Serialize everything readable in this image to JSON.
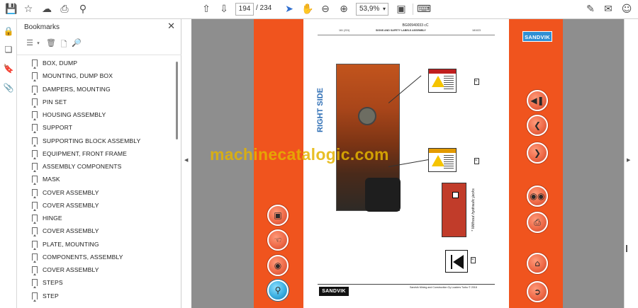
{
  "toolbar": {
    "current_page": "194",
    "total_pages": "/ 234",
    "zoom": "53,9%"
  },
  "bookmarks": {
    "title": "Bookmarks",
    "items": [
      "BOX, DUMP",
      "MOUNTING, DUMP BOX",
      "DAMPERS, MOUNTING",
      "PIN SET",
      "HOUSING ASSEMBLY",
      "SUPPORT",
      "SUPPORTING BLOCK ASSEMBLY",
      "EQUIPMENT, FRONT FRAME",
      "ASSEMBLY COMPONENTS",
      "MASK",
      "COVER ASSEMBLY",
      "COVER ASSEMBLY",
      "HINGE",
      "COVER ASSEMBLY",
      "PLATE, MOUNTING",
      "COMPONENTS, ASSEMBLY",
      "COVER ASSEMBLY",
      "STEPS",
      "STEP"
    ]
  },
  "document": {
    "doc_number": "BG00940033 cC",
    "page_ref": "161 (231)",
    "section_title": "SIGNS AND SAFETY LABELS ASSEMBLY",
    "date": "181023",
    "right_side_label": "RIGHT SIDE",
    "hydraulic_note": "* Without hydraulic jacks",
    "footer_logo": "SANDVIK",
    "footer_text": "Sandvik Mining and Construction Oy Loaders Turku © 2018",
    "tag_top": "53",
    "tag_mid": "51",
    "tag_bottom": "50",
    "sandvik_badge": "SANDVIK"
  },
  "watermark": "machinecatalogic.com"
}
